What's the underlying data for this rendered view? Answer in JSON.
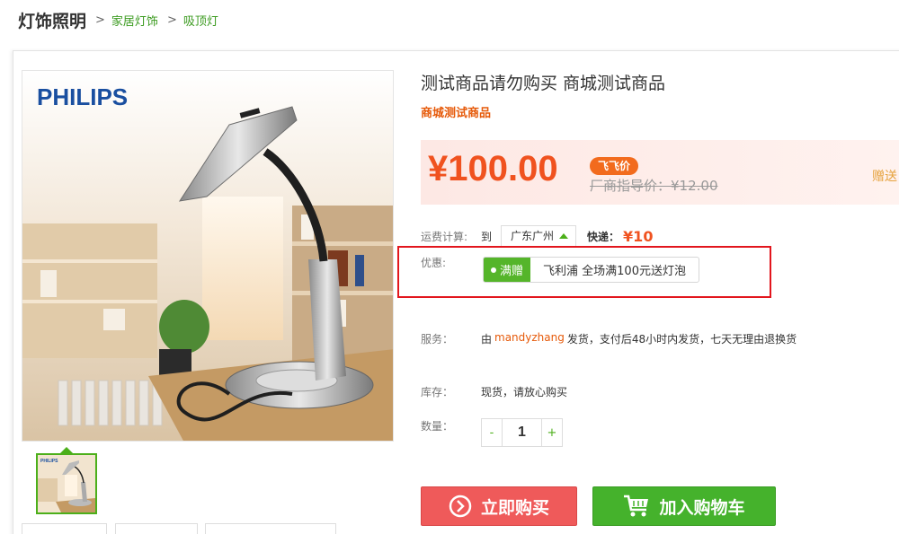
{
  "breadcrumb": {
    "root": "灯饰照明",
    "items": [
      "家居灯饰",
      "吸顶灯"
    ]
  },
  "gallery": {
    "brand": "PHILIPS",
    "thumb_brand": "PHILIPS"
  },
  "product": {
    "title": "测试商品请勿购买 商城测试商品",
    "subtitle": "商城测试商品",
    "price": "¥100.00",
    "price_tag": "飞飞价",
    "msrp": "厂商指导价：¥12.00",
    "gift_link": "赠送"
  },
  "shipping": {
    "label": "运费计算:",
    "to": "到",
    "region": "广东广州",
    "express_label": "快递：",
    "fee": "¥10"
  },
  "promo": {
    "label": "优惠:",
    "tag": "满赠",
    "text": "飞利浦 全场满100元送灯泡"
  },
  "service": {
    "label": "服务：",
    "prefix": "由",
    "seller": "mandyzhang",
    "text": "发货，支付后48小时内发货，七天无理由退换货"
  },
  "stock": {
    "label": "库存：",
    "value": "现货，请放心购买"
  },
  "quantity": {
    "label": "数量：",
    "minus": "-",
    "value": "1",
    "plus": "+"
  },
  "actions": {
    "buy": "立即购买",
    "cart": "加入购物车"
  },
  "colors": {
    "accent_green": "#45b22c",
    "price_orange": "#f0521f",
    "buy_red": "#ef5a5a",
    "highlight_red": "#e2161d"
  }
}
